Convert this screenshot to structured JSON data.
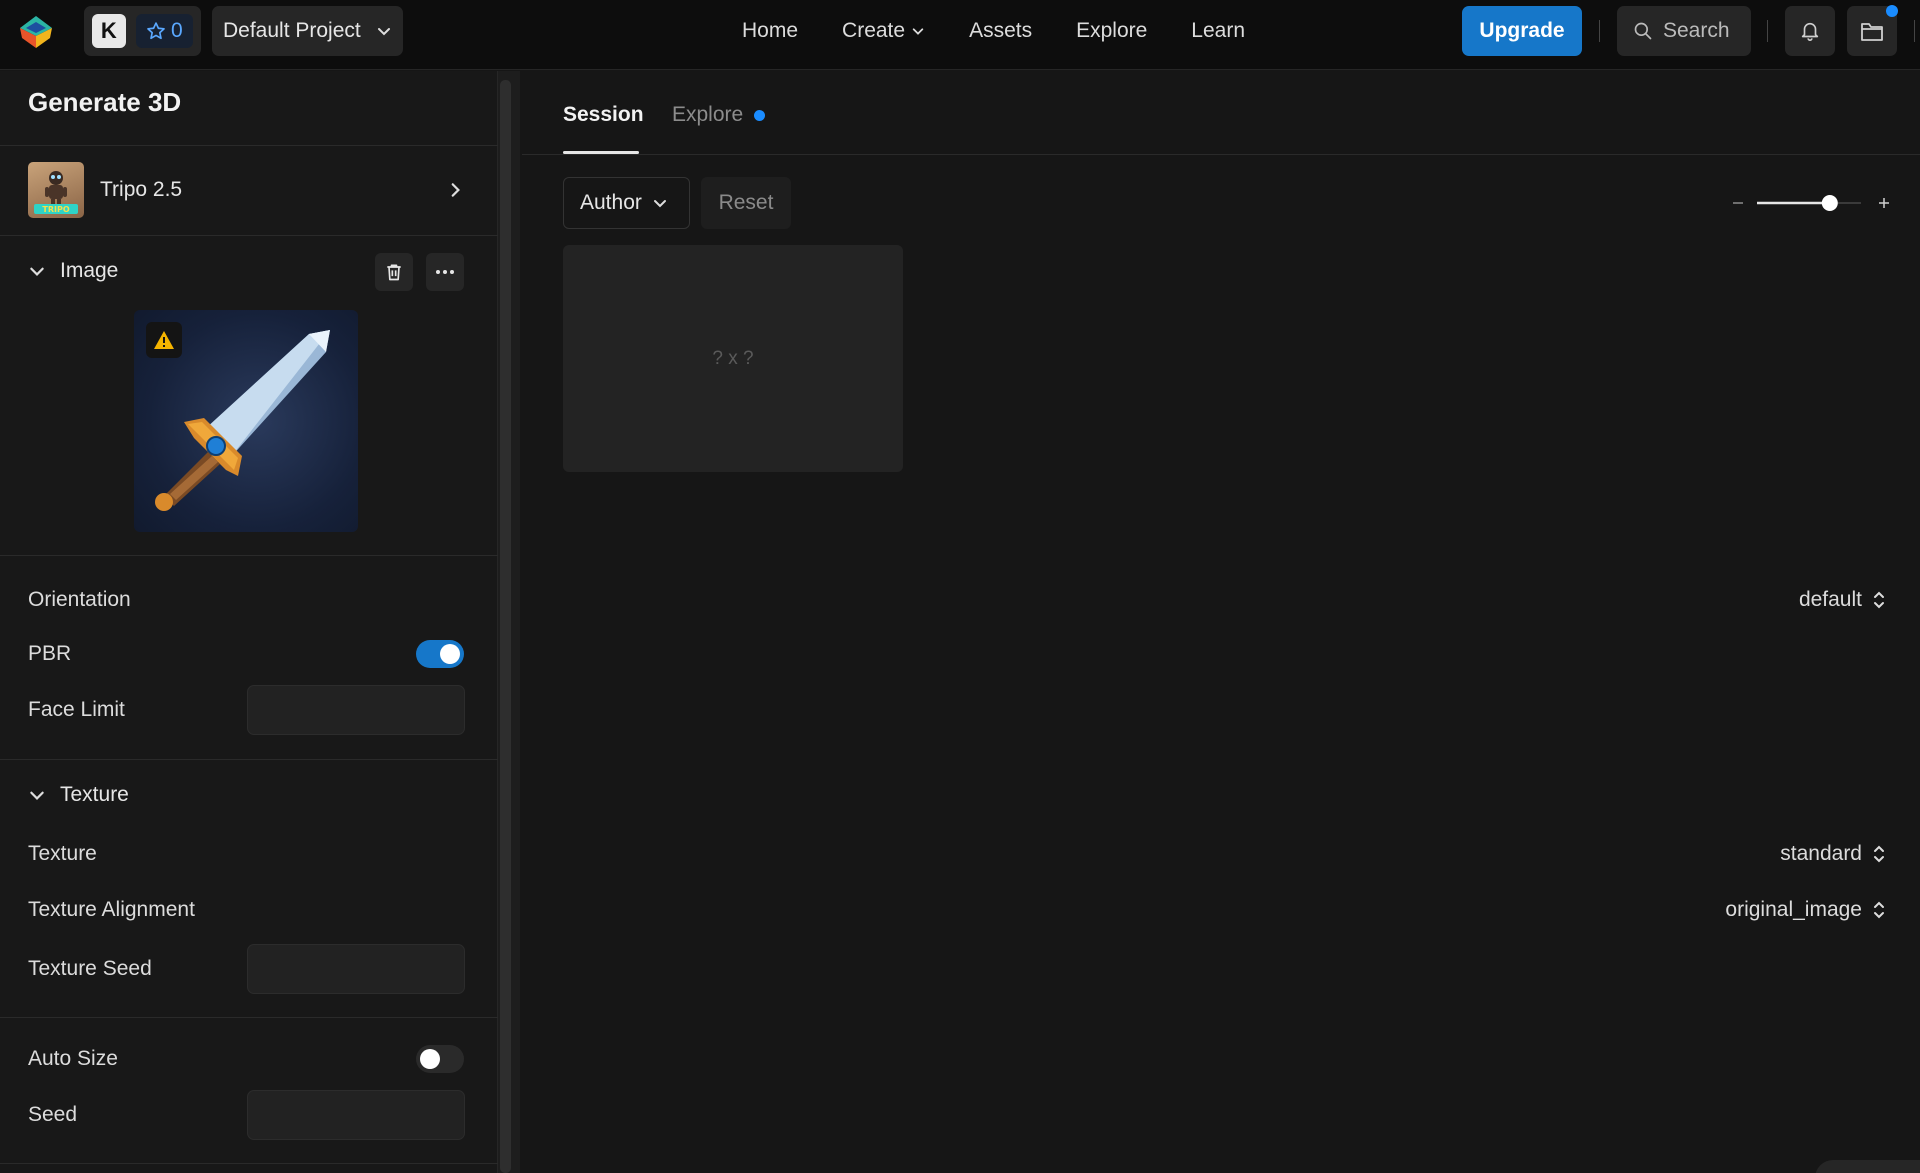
{
  "topbar": {
    "avatar_letter": "K",
    "credits": "0",
    "project": "Default Project",
    "nav": [
      "Home",
      "Create",
      "Assets",
      "Explore",
      "Learn"
    ],
    "upgrade": "Upgrade",
    "search": "Search",
    "accent": "#1677c9"
  },
  "left": {
    "title": "Generate 3D",
    "model": {
      "name": "Tripo 2.5",
      "thumb_text": "TRIPO"
    },
    "image_section": {
      "label": "Image"
    },
    "orientation": {
      "label": "Orientation",
      "value": "default"
    },
    "pbr": {
      "label": "PBR",
      "enabled": true
    },
    "face_limit": {
      "label": "Face Limit",
      "value": ""
    },
    "texture_section": {
      "label": "Texture"
    },
    "texture": {
      "label": "Texture",
      "value": "standard"
    },
    "texture_alignment": {
      "label": "Texture Alignment",
      "value": "original_image"
    },
    "texture_seed": {
      "label": "Texture Seed",
      "value": ""
    },
    "auto_size": {
      "label": "Auto Size",
      "enabled": false
    },
    "seed": {
      "label": "Seed",
      "value": ""
    }
  },
  "main": {
    "tabs": [
      {
        "label": "Session",
        "active": true
      },
      {
        "label": "Explore",
        "active": false,
        "dot": true
      }
    ],
    "filter": {
      "author": "Author",
      "reset": "Reset"
    },
    "zoom_level": 0.7,
    "card": {
      "size_text": "? x ?"
    }
  }
}
